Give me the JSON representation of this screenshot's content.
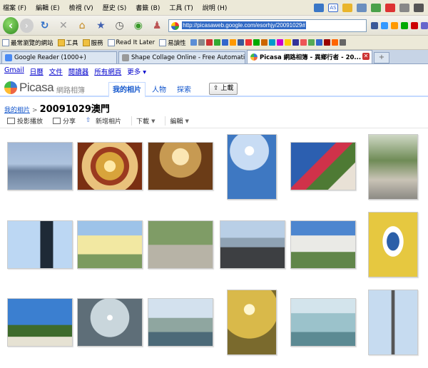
{
  "menu": [
    "檔案 (F)",
    "編輯 (E)",
    "檢視 (V)",
    "歷史 (S)",
    "書籤 (B)",
    "工具 (T)",
    "說明 (H)"
  ],
  "menu_badge": "AS",
  "address": {
    "url": "http://picasaweb.google.com/esorhjy/20091029#"
  },
  "bookmarks": [
    "最常瀏覽的網站",
    "工具",
    "服務",
    "Read It Later",
    "易讀性"
  ],
  "tabs": [
    {
      "label": "Google Reader (1000+)",
      "active": false
    },
    {
      "label": "Shape Collage Online - Free Automatic ...",
      "active": false
    },
    {
      "label": "Picasa 網路相簿 - 異鄉行者 - 20...",
      "active": true
    }
  ],
  "google_links": [
    "Gmail",
    "日曆",
    "文件",
    "閱讀器",
    "所有網頁",
    "更多 ▾"
  ],
  "picasa": {
    "logo": "Picasa",
    "logo_sub": "網路相簿",
    "tabs": [
      "我的相片",
      "人物",
      "探索"
    ],
    "upload": "上載"
  },
  "breadcrumb": {
    "root": "我的相片",
    "separator": ">",
    "title": "20091029澳門"
  },
  "actions": [
    {
      "label": "投影播放",
      "dropdown": false
    },
    {
      "label": "分享",
      "dropdown": false
    },
    {
      "label": "新增相片",
      "dropdown": false
    },
    {
      "label": "下載",
      "dropdown": true
    },
    {
      "label": "編輯",
      "dropdown": true
    }
  ],
  "photos": [
    {
      "name": "photo-hazy-hills",
      "bg": "linear-gradient(#9fb6d6 0%,#aec3de 45%,#6a7f9c 60%,#8ea3bd 100%)"
    },
    {
      "name": "photo-ornate-ceiling",
      "bg": "radial-gradient(circle at 50% 50%,#ffe9a6 0 14%,#d8a43b 15% 35%,#9b3a1f 36% 48%,#e9c27c 49% 70%,#7a2f12 71%)"
    },
    {
      "name": "photo-golden-statue",
      "bg": "radial-gradient(circle at 50% 30%,#fbe6b3 0 18%,#c79a52 19% 45%,#6b3c17 46%)"
    },
    {
      "name": "photo-signpost-sun",
      "bg": "radial-gradient(circle at 45% 25%,#fff 0 8%,#c8dcf4 9% 35%,#3e78c2 36%)"
    },
    {
      "name": "photo-red-flowers",
      "bg": "linear-gradient(135deg,#2c5fb0 0 40%,#d0324a 41% 55%,#4e7a34 56% 75%,#e9e1d6 76%)"
    },
    {
      "name": "photo-old-building",
      "bg": "linear-gradient(#cfd8c5 0%,#6f8b56 40%,#c9c3b6 70%,#8c8a84 100%)"
    },
    {
      "name": "photo-statue-silhouette",
      "bg": "linear-gradient(90deg,#bcd7f3 0 50%,#1e2a36 51% 70%,#bcd7f3 71%)"
    },
    {
      "name": "photo-church",
      "bg": "linear-gradient(#9dc3e9 0 30%,#f2e8a2 31% 70%,#7c9b5f 71%)"
    },
    {
      "name": "photo-trees-square",
      "bg": "linear-gradient(#7f9c66 0 50%,#b7b3a6 51%)"
    },
    {
      "name": "photo-harbour-bench",
      "bg": "linear-gradient(#b9cfe6 0 35%,#8fa2b4 36% 55%,#3d3f42 56%)"
    },
    {
      "name": "photo-monument-square",
      "bg": "linear-gradient(#4d86cf 0 30%,#eaeae6 31% 65%,#61864a 66%)"
    },
    {
      "name": "photo-yellow-niche",
      "bg": "radial-gradient(ellipse at 50% 45%,#2b5fa8 0 18%,#fff 19% 30%,#e6c840 31%)"
    },
    {
      "name": "photo-park-blue-sky",
      "bg": "linear-gradient(#3b7fd0 0 55%,#3e6b2c 56% 80%,#e6e2d3 81%)"
    },
    {
      "name": "photo-sunset-water",
      "bg": "radial-gradient(circle at 50% 40%,#fff 0 6%,#c9d6dc 7% 45%,#5e6e78 46%)"
    },
    {
      "name": "photo-city-skyline",
      "bg": "linear-gradient(#d3e1ee 0 40%,#8fa6a0 41% 70%,#4c6a78 71%)"
    },
    {
      "name": "photo-golden-water",
      "bg": "radial-gradient(circle at 45% 30%,#fff7d0 0 10%,#d9b94a 11% 55%,#7a6a2d 56%)"
    },
    {
      "name": "photo-bridge-sea",
      "bg": "linear-gradient(#d3e4ec 0 30%,#9bc2cb 31% 70%,#5c8a93 71%)"
    },
    {
      "name": "photo-macau-tower",
      "bg": "linear-gradient(90deg,#c6dbf0 0 46%,#555 47% 53%,#c6dbf0 54%)"
    }
  ]
}
